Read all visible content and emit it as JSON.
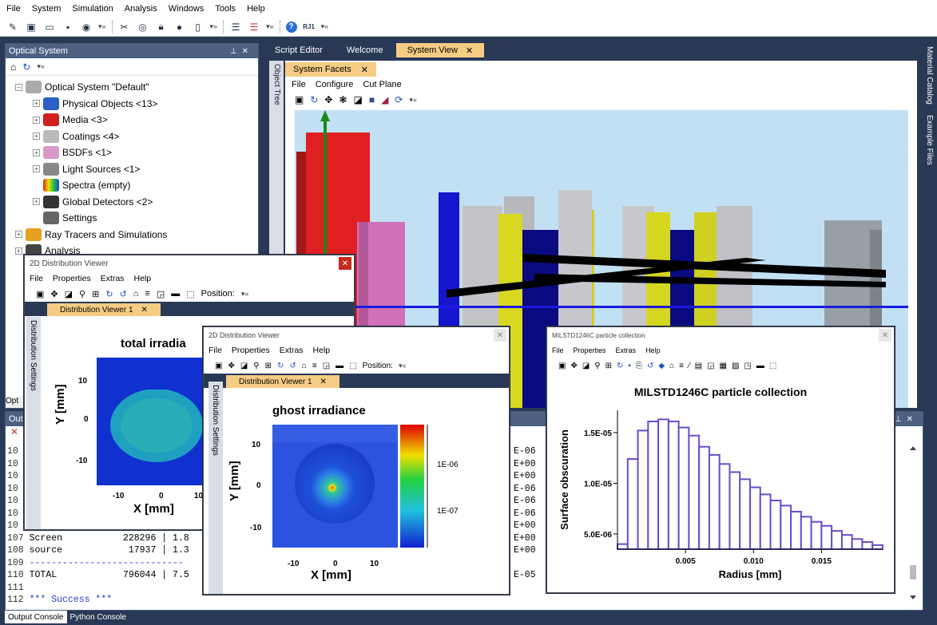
{
  "menubar": [
    "File",
    "System",
    "Simulation",
    "Analysis",
    "Windows",
    "Tools",
    "Help"
  ],
  "optical_panel": {
    "title": "Optical System",
    "tree": [
      {
        "label": "Optical System \"Default\"",
        "icon": "gear-icon",
        "indent": 0
      },
      {
        "label": "Physical Objects <13>",
        "icon": "objects-icon",
        "indent": 1
      },
      {
        "label": "Media <3>",
        "icon": "media-icon",
        "indent": 1
      },
      {
        "label": "Coatings <4>",
        "icon": "coatings-icon",
        "indent": 1
      },
      {
        "label": "BSDFs <1>",
        "icon": "bsdf-icon",
        "indent": 1
      },
      {
        "label": "Light Sources <1>",
        "icon": "light-icon",
        "indent": 1
      },
      {
        "label": "Spectra (empty)",
        "icon": "spectra-icon",
        "indent": 1
      },
      {
        "label": "Global Detectors <2>",
        "icon": "detector-icon",
        "indent": 1
      },
      {
        "label": "Settings",
        "icon": "settings-icon",
        "indent": 1
      },
      {
        "label": "Ray Tracers and Simulations",
        "icon": "raytracer-icon",
        "indent": 0
      },
      {
        "label": "Analysis",
        "icon": "analysis-icon",
        "indent": 0
      }
    ],
    "bottom_tab": "Opt"
  },
  "object_tree_label": "Object Tree",
  "doc_tabs": [
    {
      "label": "Script Editor",
      "active": false
    },
    {
      "label": "Welcome",
      "active": false
    },
    {
      "label": "System View",
      "active": true
    }
  ],
  "system_view": {
    "tab": "System Facets",
    "menu": [
      "File",
      "Configure",
      "Cut Plane"
    ]
  },
  "right_tabs": [
    "Material Catalog",
    "Example Files"
  ],
  "output": {
    "title": "Out",
    "lines": [
      {
        "num": "10",
        "text": ""
      },
      {
        "num": "10",
        "text": ""
      },
      {
        "num": "10",
        "text": ""
      },
      {
        "num": "10",
        "text": ""
      },
      {
        "num": "10",
        "text": ""
      },
      {
        "num": "10",
        "text": ""
      },
      {
        "num": "10",
        "text": ""
      },
      {
        "num": "107",
        "text": " Screen           228296 | 1.8"
      },
      {
        "num": "108",
        "text": " source            17937 | 1.3"
      },
      {
        "num": "109",
        "text": " ----------------------------"
      },
      {
        "num": "110",
        "text": " TOTAL            796044 | 7.5"
      },
      {
        "num": "111",
        "text": ""
      },
      {
        "num": "112",
        "text": " *** Success ***"
      }
    ],
    "right_lines": [
      "E-06",
      "E+00",
      "E+00",
      "E-06",
      "E-06",
      "E-06",
      "E+00",
      "E+00",
      "E+00",
      "",
      "E-05"
    ],
    "tabs": [
      "Output Console",
      "Python Console"
    ]
  },
  "viewer1": {
    "title": "2D Distribution Viewer",
    "menu": [
      "File",
      "Properties",
      "Extras",
      "Help"
    ],
    "position_label": "Position:",
    "tab": "Distribution Viewer 1",
    "side": "Distribution Settings",
    "plot_title": "total irradia",
    "xlabel": "X [mm]",
    "ylabel": "Y [mm]",
    "xticks": [
      "-10",
      "0",
      "10"
    ],
    "yticks": [
      "10",
      "0",
      "-10"
    ]
  },
  "viewer2": {
    "title": "2D Distribution Viewer",
    "menu": [
      "File",
      "Properties",
      "Extras",
      "Help"
    ],
    "position_label": "Position:",
    "tab": "Distribution Viewer 1",
    "side": "Distribution Settings",
    "plot_title": "ghost irradiance",
    "xlabel": "X [mm]",
    "ylabel": "Y [mm]",
    "xticks": [
      "-10",
      "0",
      "10"
    ],
    "yticks": [
      "10",
      "0",
      "-10"
    ],
    "colorbar_ticks": [
      "1E-06",
      "1E-07"
    ]
  },
  "viewer3": {
    "title": "MILSTD1246C particle collection",
    "menu": [
      "File",
      "Properties",
      "Extras",
      "Help"
    ]
  },
  "chart_data": {
    "type": "bar",
    "title": "MILSTD1246C particle collection",
    "xlabel": "Radius [mm]",
    "ylabel": "Surface obscuration",
    "x_ticks": [
      "0.005",
      "0.010",
      "0.015"
    ],
    "y_ticks": [
      "5.0E-06",
      "1.0E-05",
      "1.5E-05"
    ],
    "xlim": [
      0,
      0.0195
    ],
    "ylim": [
      3.5e-06,
      1.72e-05
    ],
    "bin_width": 0.00075,
    "bin_starts": [
      0,
      0.00075,
      0.0015,
      0.00225,
      0.003,
      0.00375,
      0.0045,
      0.00525,
      0.006,
      0.00675,
      0.0075,
      0.00825,
      0.009,
      0.00975,
      0.0105,
      0.01125,
      0.012,
      0.01275,
      0.0135,
      0.01425,
      0.015,
      0.01575,
      0.0165,
      0.01725,
      0.018,
      0.01875
    ],
    "values": [
      4e-06,
      1.24e-05,
      1.52e-05,
      1.61e-05,
      1.63e-05,
      1.61e-05,
      1.55e-05,
      1.47e-05,
      1.36e-05,
      1.28e-05,
      1.19e-05,
      1.11e-05,
      1.04e-05,
      9.6e-06,
      8.9e-06,
      8.3e-06,
      7.8e-06,
      7.2e-06,
      6.7e-06,
      6.2e-06,
      5.8e-06,
      5.3e-06,
      4.9e-06,
      4.5e-06,
      4.2e-06,
      3.9e-06
    ],
    "bar_color": "#6a4ccd"
  },
  "colors": {
    "accent_tab": "#f5cc84",
    "panel_header": "#4d6082",
    "app_bg": "#293955"
  }
}
